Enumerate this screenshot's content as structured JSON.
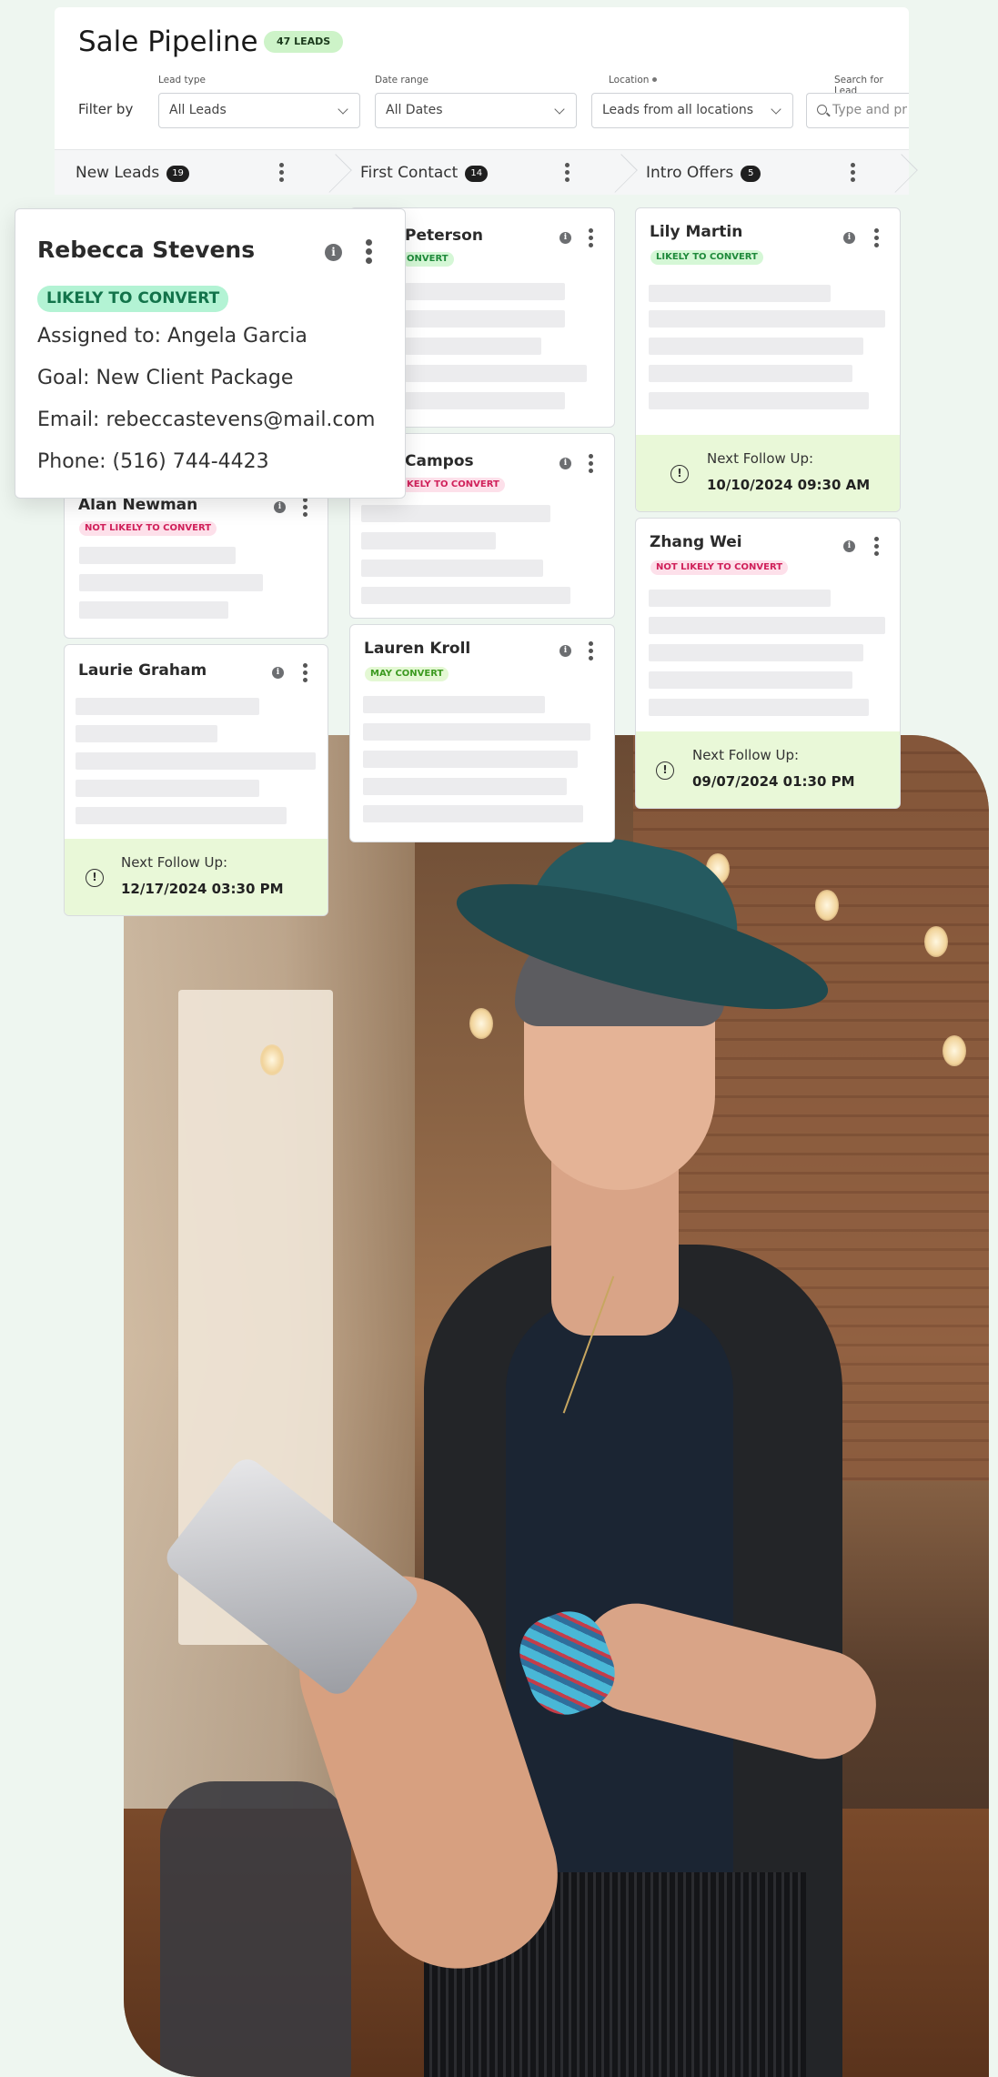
{
  "header": {
    "title": "Sale Pipeline",
    "leads_badge": "47 LEADS",
    "filter_by": "Filter by"
  },
  "filters": {
    "lead_type": {
      "label": "Lead type",
      "value": "All Leads"
    },
    "date_range": {
      "label": "Date range",
      "value": "All Dates"
    },
    "location": {
      "label": "Location",
      "value": "Leads from all locations"
    },
    "search": {
      "label": "Search for Lead",
      "placeholder": "Type and pr"
    }
  },
  "stages": [
    {
      "label": "New Leads",
      "count": "19"
    },
    {
      "label": "First Contact",
      "count": "14"
    },
    {
      "label": "Intro Offers",
      "count": "5"
    }
  ],
  "popover": {
    "name": "Rebecca Stevens",
    "status": "LIKELY TO CONVERT",
    "assigned": "Assigned to: Angela Garcia",
    "goal": "Goal: New Client Package",
    "email": "Email: rebeccastevens@mail.com",
    "phone": "Phone: (516) 744-4423"
  },
  "cards": {
    "alan": {
      "name": "Alan Newman",
      "status": "NOT LIKELY TO CONVERT"
    },
    "laurie": {
      "name": "Laurie Graham",
      "follow_label": "Next Follow Up:",
      "follow_value": "12/17/2024 03:30 PM"
    },
    "peterson": {
      "name": "Peterson",
      "status": "ONVERT"
    },
    "campos": {
      "name": "Campos",
      "status": "KELY TO CONVERT"
    },
    "lauren": {
      "name": "Lauren Kroll",
      "status": "MAY CONVERT"
    },
    "lily": {
      "name": "Lily Martin",
      "status": "LIKELY TO CONVERT",
      "follow_label": "Next Follow Up:",
      "follow_value": "10/10/2024 09:30 AM"
    },
    "zhang": {
      "name": "Zhang Wei",
      "status": "NOT LIKELY TO CONVERT",
      "follow_label": "Next Follow Up:",
      "follow_value": "09/07/2024 01:30 PM"
    }
  },
  "icons": {
    "info": "i",
    "alert": "!"
  },
  "colors": {
    "page_bg": "#eef6f0",
    "likely": "#1f8a3b",
    "not_likely": "#d0205a",
    "follow_bg": "#e9f8d8",
    "leads_badge_bg": "#cdf3c8"
  }
}
